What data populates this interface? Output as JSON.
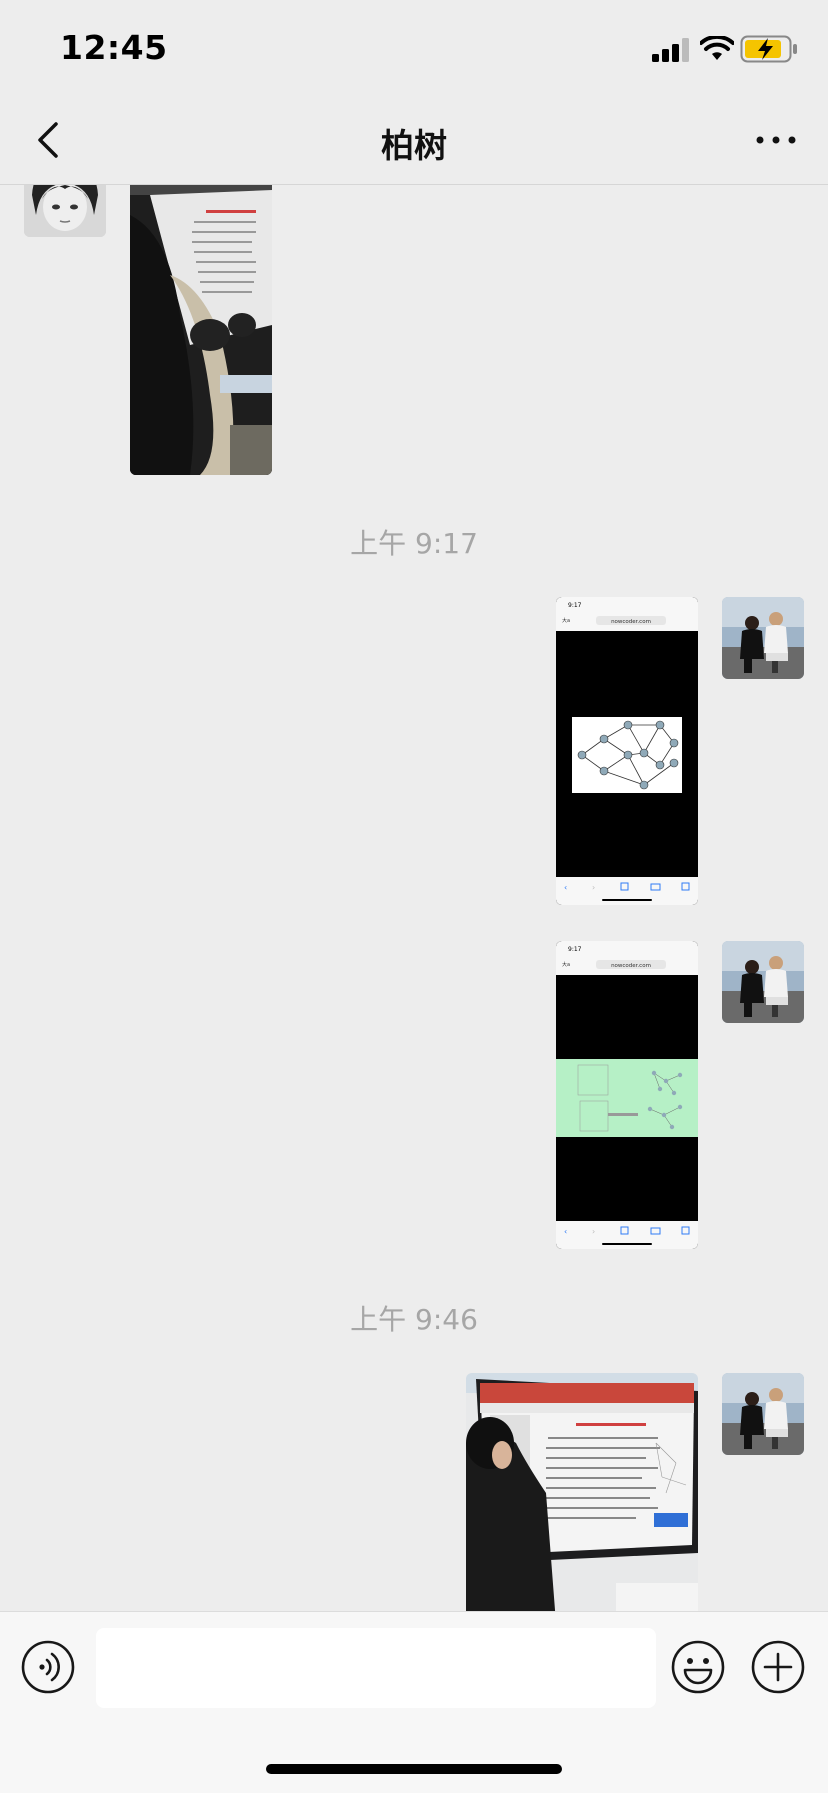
{
  "status": {
    "time": "12:45"
  },
  "header": {
    "title": "柏树"
  },
  "messages": {
    "ts1": "上午 9:17",
    "ts2": "上午 9:46"
  },
  "screenshot": {
    "time": "9:17",
    "url": "nowcoder.com",
    "aa": "大a"
  },
  "input": {
    "placeholder": ""
  },
  "icons": {
    "back": "chevron-left-icon",
    "more": "more-icon",
    "voice": "voice-icon",
    "emoji": "emoji-icon",
    "plus": "plus-icon"
  }
}
